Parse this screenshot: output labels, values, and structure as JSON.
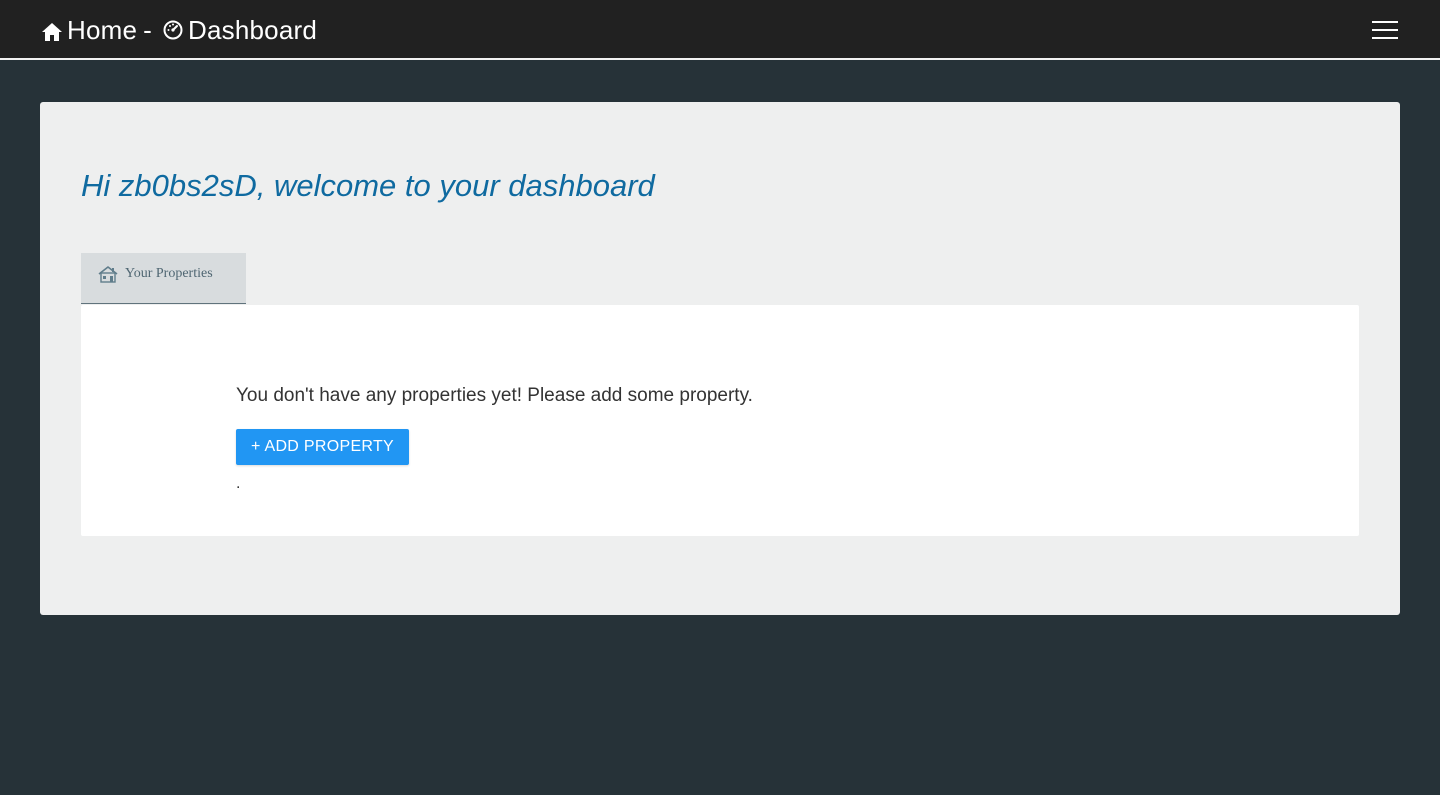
{
  "navbar": {
    "home_label": "Home",
    "separator": "-",
    "dashboard_label": "Dashboard"
  },
  "main": {
    "welcome": "Hi zb0bs2sD, welcome to your dashboard",
    "tabs": [
      {
        "label": "Your Properties",
        "icon": "house-icon"
      }
    ],
    "panel": {
      "empty_message": "You don't have any properties yet! Please add some property.",
      "add_button_label": "+ ADD PROPERTY",
      "trailing_text": "."
    }
  },
  "colors": {
    "navbar_bg": "#212121",
    "page_bg": "#263238",
    "card_bg": "#eeefef",
    "welcome_text": "#0f6aa0",
    "button_bg": "#2196f3",
    "tab_bg": "#d8dcde"
  }
}
